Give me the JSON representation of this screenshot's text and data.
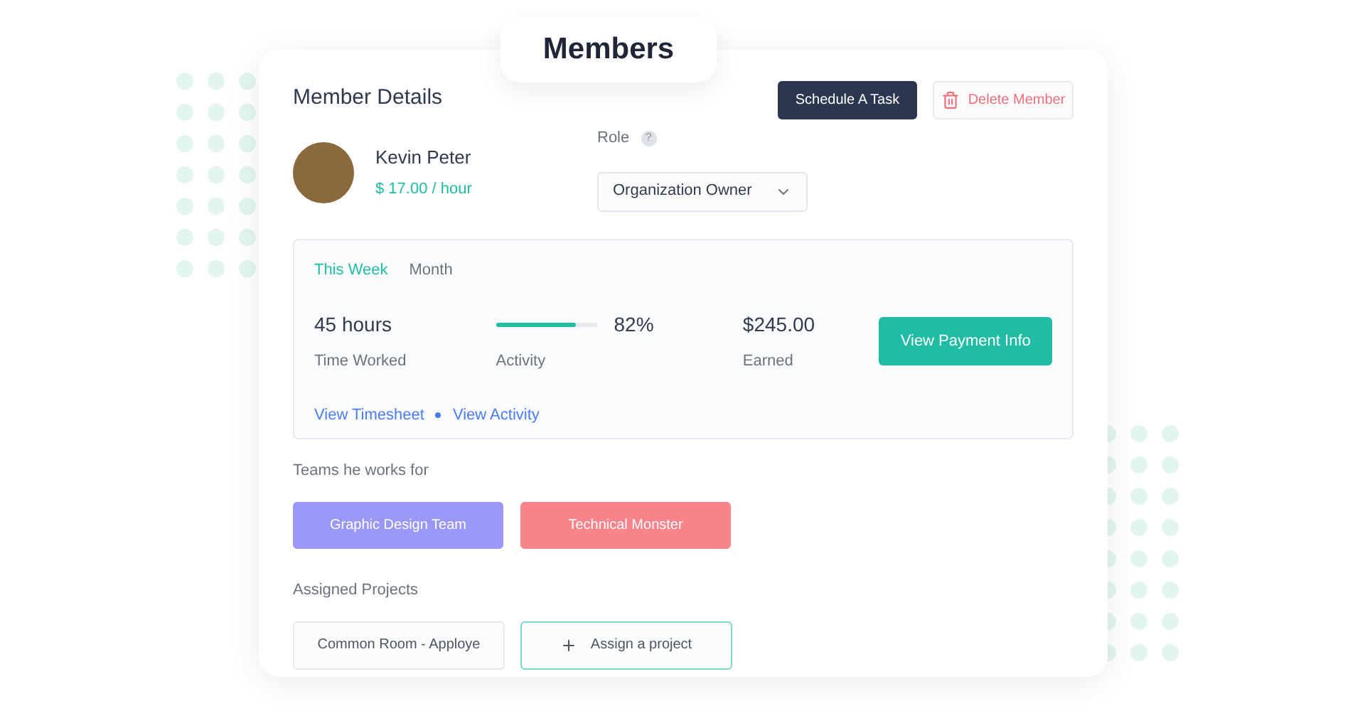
{
  "page_title": "Members",
  "header": {
    "title": "Member Details",
    "buttons": [
      {
        "label": "Schedule A Task",
        "kind": "primary"
      },
      {
        "label": "Delete Member",
        "kind": "danger"
      }
    ]
  },
  "member": {
    "name": "Kevin Peter",
    "rate": "$ 17.00 / hour"
  },
  "role": {
    "label": "Role",
    "help": "?",
    "value": "Organization Owner"
  },
  "stats": {
    "tabs": [
      {
        "label": "This Week",
        "selected": true
      },
      {
        "label": "Month",
        "selected": false
      }
    ],
    "time": {
      "value": "45 hours",
      "label": "Time Worked"
    },
    "activity": {
      "level": 0.79,
      "reading": "82%",
      "label": "Activity"
    },
    "earned": {
      "value": "$245.00",
      "label": "Earned"
    },
    "payment_button": "View Payment Info",
    "links": [
      "View Timesheet",
      "View Activity"
    ]
  },
  "teams": {
    "title": "Teams he works for",
    "items": [
      {
        "name": "Graphic Design Team",
        "color": "#9b97f7"
      },
      {
        "name": "Technical Monster",
        "color": "#f9838b"
      }
    ]
  },
  "projects": {
    "title": "Assigned Projects",
    "items": [
      "Common Room - Apploye"
    ],
    "add_button": "Assign a project"
  }
}
